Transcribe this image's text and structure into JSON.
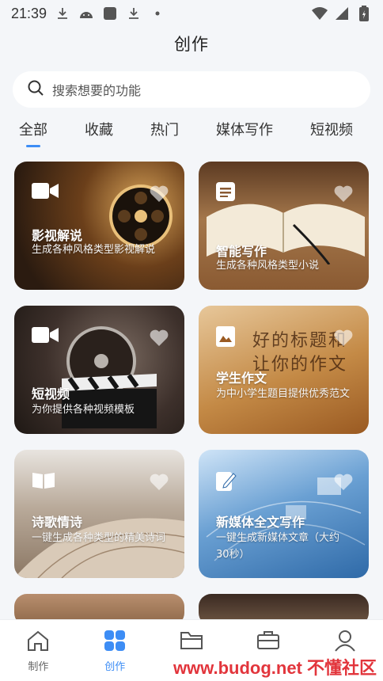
{
  "status_bar": {
    "time": "21:39"
  },
  "header": {
    "title": "创作"
  },
  "search": {
    "placeholder": "搜索想要的功能"
  },
  "tabs": [
    {
      "label": "全部",
      "active": true
    },
    {
      "label": "收藏"
    },
    {
      "label": "热门"
    },
    {
      "label": "媒体写作"
    },
    {
      "label": "短视频"
    }
  ],
  "cards": [
    {
      "title": "影视解说",
      "desc": "生成各种风格类型影视解说",
      "icon": "video-camera-icon"
    },
    {
      "title": "智能写作",
      "desc": "生成各种风格类型小说",
      "icon": "list-doc-icon"
    },
    {
      "title": "短视频",
      "desc": "为你提供各种视频模板",
      "icon": "video-camera-icon"
    },
    {
      "title": "学生作文",
      "desc": "为中小学生题目提供优秀范文",
      "icon": "image-doc-icon",
      "bg_text": "好的标题和 让你的作文"
    },
    {
      "title": "诗歌情诗",
      "desc": "一键生成各种类型的精美诗词",
      "icon": "open-book-icon"
    },
    {
      "title": "新媒体全文写作",
      "desc": "一键生成新媒体文章（大约30秒）",
      "icon": "edit-doc-icon"
    }
  ],
  "bottom_nav": [
    {
      "label": "制作",
      "icon": "home-icon"
    },
    {
      "label": "创作",
      "icon": "grid-icon",
      "active": true
    },
    {
      "label": "",
      "icon": "folder-icon"
    },
    {
      "label": "",
      "icon": "briefcase-icon"
    },
    {
      "label": "",
      "icon": "user-icon"
    }
  ],
  "watermark": "www.budog.net 不懂社区",
  "colors": {
    "accent": "#3d8df5",
    "background": "#f4f6f9"
  }
}
